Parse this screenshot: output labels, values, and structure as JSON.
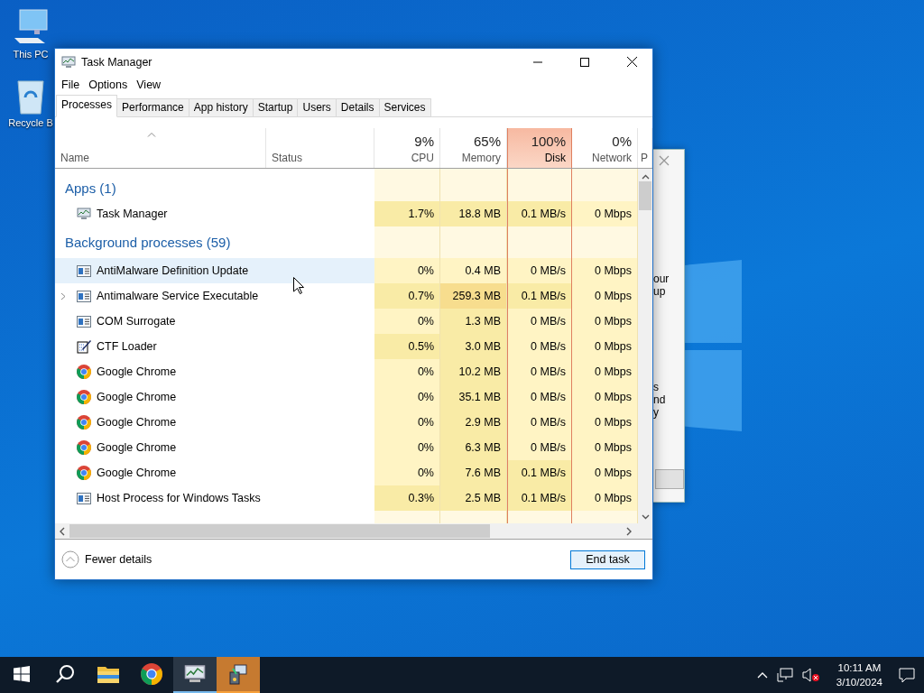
{
  "desktop_icons": [
    {
      "label": "This PC",
      "kind": "pc"
    },
    {
      "label": "Recycle B",
      "kind": "bin"
    }
  ],
  "background_dialog": {
    "lines": [
      "our",
      "up",
      "s",
      "nd",
      "y"
    ]
  },
  "window": {
    "title": "Task Manager",
    "menu": [
      "File",
      "Options",
      "View"
    ],
    "tabs": [
      {
        "label": "Processes",
        "selected": true
      },
      {
        "label": "Performance",
        "selected": false
      },
      {
        "label": "App history",
        "selected": false
      },
      {
        "label": "Startup",
        "selected": false
      },
      {
        "label": "Users",
        "selected": false
      },
      {
        "label": "Details",
        "selected": false
      },
      {
        "label": "Services",
        "selected": false
      }
    ],
    "columns": [
      {
        "kind": "text",
        "title": "Name",
        "sorted": true
      },
      {
        "kind": "text",
        "title": "Status",
        "sorted": false
      },
      {
        "kind": "meter",
        "value": "9%",
        "title": "CPU",
        "alert": false
      },
      {
        "kind": "meter",
        "value": "65%",
        "title": "Memory",
        "alert": false
      },
      {
        "kind": "meter",
        "value": "100%",
        "title": "Disk",
        "alert": true
      },
      {
        "kind": "meter",
        "value": "0%",
        "title": "Network",
        "alert": false
      },
      {
        "kind": "partial",
        "title": "P"
      }
    ],
    "groups": [
      {
        "title": "Apps (1)",
        "rows": [
          {
            "name": "Task Manager",
            "kind": "monitor",
            "expandable": false,
            "selected": false,
            "cells": [
              {
                "text": "1.7%",
                "color": "#f9eba6"
              },
              {
                "text": "18.8 MB",
                "color": "#f9eba6"
              },
              {
                "text": "0.1 MB/s",
                "color": "#f9eba6"
              },
              {
                "text": "0 Mbps",
                "color": "#fff4c4"
              }
            ]
          }
        ]
      },
      {
        "title": "Background processes (59)",
        "rows": [
          {
            "name": "AntiMalware Definition Update",
            "kind": "service",
            "expandable": false,
            "selected": true,
            "cells": [
              {
                "text": "0%",
                "color": "#fff4c4"
              },
              {
                "text": "0.4 MB",
                "color": "#fff4c4"
              },
              {
                "text": "0 MB/s",
                "color": "#fff4c4"
              },
              {
                "text": "0 Mbps",
                "color": "#fff4c4"
              }
            ]
          },
          {
            "name": "Antimalware Service Executable",
            "kind": "service",
            "expandable": true,
            "selected": false,
            "cells": [
              {
                "text": "0.7%",
                "color": "#f9eba6"
              },
              {
                "text": "259.3 MB",
                "color": "#f7dd8e"
              },
              {
                "text": "0.1 MB/s",
                "color": "#f9eba6"
              },
              {
                "text": "0 Mbps",
                "color": "#fff4c4"
              }
            ]
          },
          {
            "name": "COM Surrogate",
            "kind": "service",
            "expandable": false,
            "selected": false,
            "cells": [
              {
                "text": "0%",
                "color": "#fff4c4"
              },
              {
                "text": "1.3 MB",
                "color": "#f9eba6"
              },
              {
                "text": "0 MB/s",
                "color": "#fff4c4"
              },
              {
                "text": "0 Mbps",
                "color": "#fff4c4"
              }
            ]
          },
          {
            "name": "CTF Loader",
            "kind": "notepad",
            "expandable": false,
            "selected": false,
            "cells": [
              {
                "text": "0.5%",
                "color": "#f9eba6"
              },
              {
                "text": "3.0 MB",
                "color": "#f9eba6"
              },
              {
                "text": "0 MB/s",
                "color": "#fff4c4"
              },
              {
                "text": "0 Mbps",
                "color": "#fff4c4"
              }
            ]
          },
          {
            "name": "Google Chrome",
            "kind": "chrome",
            "expandable": false,
            "selected": false,
            "cells": [
              {
                "text": "0%",
                "color": "#fff4c4"
              },
              {
                "text": "10.2 MB",
                "color": "#f9eba6"
              },
              {
                "text": "0 MB/s",
                "color": "#fff4c4"
              },
              {
                "text": "0 Mbps",
                "color": "#fff4c4"
              }
            ]
          },
          {
            "name": "Google Chrome",
            "kind": "chrome",
            "expandable": false,
            "selected": false,
            "cells": [
              {
                "text": "0%",
                "color": "#fff4c4"
              },
              {
                "text": "35.1 MB",
                "color": "#f9eba6"
              },
              {
                "text": "0 MB/s",
                "color": "#fff4c4"
              },
              {
                "text": "0 Mbps",
                "color": "#fff4c4"
              }
            ]
          },
          {
            "name": "Google Chrome",
            "kind": "chrome",
            "expandable": false,
            "selected": false,
            "cells": [
              {
                "text": "0%",
                "color": "#fff4c4"
              },
              {
                "text": "2.9 MB",
                "color": "#f9eba6"
              },
              {
                "text": "0 MB/s",
                "color": "#fff4c4"
              },
              {
                "text": "0 Mbps",
                "color": "#fff4c4"
              }
            ]
          },
          {
            "name": "Google Chrome",
            "kind": "chrome",
            "expandable": false,
            "selected": false,
            "cells": [
              {
                "text": "0%",
                "color": "#fff4c4"
              },
              {
                "text": "6.3 MB",
                "color": "#f9eba6"
              },
              {
                "text": "0 MB/s",
                "color": "#fff4c4"
              },
              {
                "text": "0 Mbps",
                "color": "#fff4c4"
              }
            ]
          },
          {
            "name": "Google Chrome",
            "kind": "chrome",
            "expandable": false,
            "selected": false,
            "cells": [
              {
                "text": "0%",
                "color": "#fff4c4"
              },
              {
                "text": "7.6 MB",
                "color": "#f9eba6"
              },
              {
                "text": "0.1 MB/s",
                "color": "#f9eba6"
              },
              {
                "text": "0 Mbps",
                "color": "#fff4c4"
              }
            ]
          },
          {
            "name": "Host Process for Windows Tasks",
            "kind": "service",
            "expandable": false,
            "selected": false,
            "cells": [
              {
                "text": "0.3%",
                "color": "#f9eba6"
              },
              {
                "text": "2.5 MB",
                "color": "#f9eba6"
              },
              {
                "text": "0.1 MB/s",
                "color": "#f9eba6"
              },
              {
                "text": "0 Mbps",
                "color": "#fff4c4"
              }
            ]
          }
        ]
      }
    ],
    "footer": {
      "toggle": "Fewer details",
      "action": "End task"
    }
  },
  "taskbar": {
    "items": [
      {
        "kind": "start",
        "running": false,
        "flashing": false
      },
      {
        "kind": "search",
        "running": false,
        "flashing": false
      },
      {
        "kind": "folder",
        "running": false,
        "flashing": false
      },
      {
        "kind": "chrome",
        "running": false,
        "flashing": false
      },
      {
        "kind": "monitor",
        "running": true,
        "flashing": false
      },
      {
        "kind": "installer",
        "running": false,
        "flashing": true
      }
    ],
    "tray": {
      "time": "10:11 AM",
      "date": "3/10/2024"
    }
  }
}
